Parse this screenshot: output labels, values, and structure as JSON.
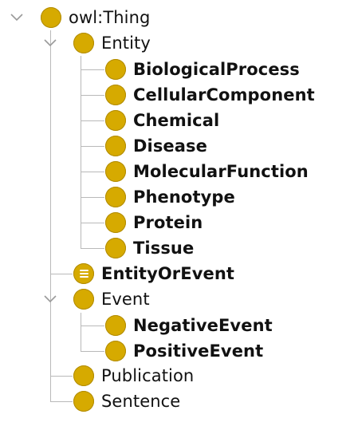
{
  "colors": {
    "class_icon": "#d6aa00",
    "tree_line": "#b9b9b9",
    "toggle_chevron": "#9a9a9a",
    "background": "#ffffff"
  },
  "tree": {
    "root": {
      "label": "owl:Thing",
      "expanded": true,
      "icon": "owl-class-icon"
    },
    "entity": {
      "label": "Entity",
      "expanded": true,
      "icon": "owl-class-icon"
    },
    "entity_children": [
      {
        "label": "BiologicalProcess"
      },
      {
        "label": "CellularComponent"
      },
      {
        "label": "Chemical"
      },
      {
        "label": "Disease"
      },
      {
        "label": "MolecularFunction"
      },
      {
        "label": "Phenotype"
      },
      {
        "label": "Protein"
      },
      {
        "label": "Tissue"
      }
    ],
    "entity_or_event": {
      "label": "EntityOrEvent",
      "icon": "defined-class-icon"
    },
    "event": {
      "label": "Event",
      "expanded": true,
      "icon": "owl-class-icon"
    },
    "event_children": [
      {
        "label": "NegativeEvent"
      },
      {
        "label": "PositiveEvent"
      }
    ],
    "publication": {
      "label": "Publication",
      "icon": "owl-class-icon"
    },
    "sentence": {
      "label": "Sentence",
      "icon": "owl-class-icon"
    }
  }
}
